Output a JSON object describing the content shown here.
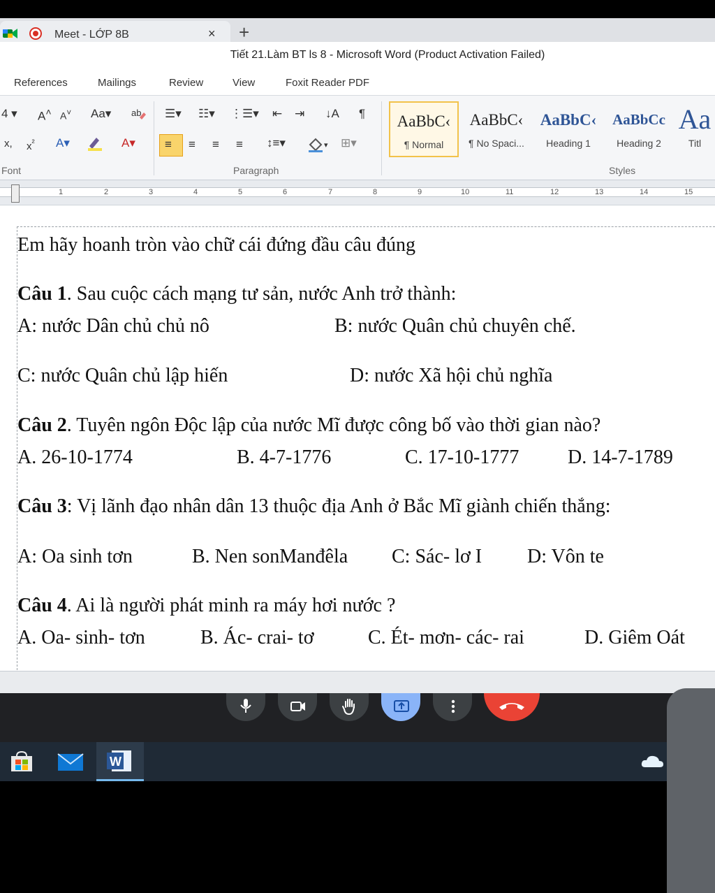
{
  "browser": {
    "tab_title": "Meet - LỚP 8B",
    "close_glyph": "×",
    "new_tab_glyph": "+"
  },
  "word": {
    "title": "Tiết 21.Làm BT ls 8  -  Microsoft Word (Product Activation Failed)",
    "menu": [
      "References",
      "Mailings",
      "Review",
      "View",
      "Foxit Reader PDF"
    ],
    "groups": {
      "font": "Font",
      "paragraph": "Paragraph",
      "styles": "Styles"
    },
    "styles": [
      {
        "sample": "AaBbC‹",
        "name": "¶ Normal",
        "selected": true
      },
      {
        "sample": "AaBbC‹",
        "name": "¶ No Spaci...",
        "selected": false
      },
      {
        "sample": "AaBbC‹",
        "name": "Heading 1",
        "selected": false
      },
      {
        "sample": "AaBbCc",
        "name": "Heading 2",
        "selected": false
      },
      {
        "sample": "Aa",
        "name": "Titl",
        "selected": false
      }
    ],
    "ruler_numbers": [
      "1",
      "2",
      "3",
      "4",
      "5",
      "6",
      "7",
      "8",
      "9",
      "10",
      "11",
      "12",
      "13",
      "14",
      "15"
    ]
  },
  "document": {
    "instruction": "Em hãy hoanh tròn vào chữ cái đứng đầu câu đúng",
    "questions": [
      {
        "label": "Câu 1",
        "text": ". Sau cuộc cách mạng tư sản, nước Anh trở thành:",
        "options": [
          "A: nước Dân chủ chủ nô",
          "B: nước Quân chủ chuyên chế.",
          "C: nước Quân chủ lập hiến",
          "D: nước Xã hội chủ nghĩa"
        ]
      },
      {
        "label": "Câu 2",
        "text": ". Tuyên ngôn Độc lập của nước Mĩ được công bố vào thời gian nào?",
        "options": [
          "A. 26-10-1774",
          "B. 4-7-1776",
          "C. 17-10-1777",
          "D. 14-7-1789"
        ]
      },
      {
        "label": "Câu 3",
        "text": ": Vị lãnh đạo nhân dân 13 thuộc địa Anh ở  Bắc Mĩ giành chiến thắng:",
        "options": [
          "A: Oa sinh tơn",
          "B. Nen sonManđêla",
          "C:  Sác- lơ I",
          "D: Vôn te"
        ]
      },
      {
        "label": "Câu 4",
        "text": ". Ai là người phát minh ra máy hơi nước ?",
        "options": [
          "A. Oa- sinh- tơn",
          "B. Ác- crai- tơ",
          "C. Ét- mơn- các- rai",
          "D. Giêm Oát"
        ]
      }
    ]
  },
  "meet_controls": {
    "icons": [
      "microphone-icon",
      "camera-icon",
      "raise-hand-icon",
      "present-screen-icon",
      "more-options-icon",
      "hang-up-icon"
    ],
    "colors": {
      "bar": "#202124",
      "button": "#3c4043",
      "present": "#8ab4f8",
      "hangup": "#ea4335"
    }
  },
  "taskbar": {
    "icons": [
      "store-icon",
      "mail-icon",
      "word-icon",
      "onedrive-icon"
    ],
    "word_glyph": "W"
  }
}
